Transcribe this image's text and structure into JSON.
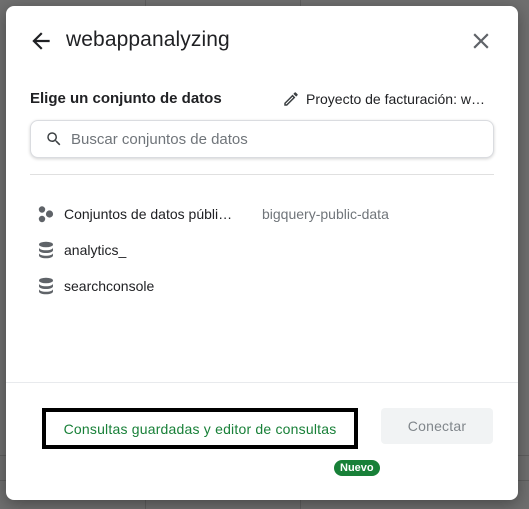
{
  "dialog": {
    "title": "webappanalyzing",
    "section_label": "Elige un conjunto de datos",
    "project_label": "Proyecto de facturación: w…",
    "search": {
      "placeholder": "Buscar conjuntos de datos",
      "value": ""
    },
    "datasets": [
      {
        "name": "Conjuntos de datos públi…",
        "subtitle": "bigquery-public-data",
        "icon": "public-datasets-icon"
      },
      {
        "name": "analytics_",
        "subtitle": "",
        "icon": "database-icon"
      },
      {
        "name": "searchconsole",
        "subtitle": "",
        "icon": "database-icon"
      }
    ],
    "saved_queries_label": "Consultas guardadas y editor de consultas",
    "new_badge": "Nuevo",
    "connect_label": "Conectar"
  },
  "colors": {
    "accent_green": "#188038",
    "text_primary": "#202124",
    "text_secondary": "#70757a",
    "disabled_button_bg": "#f1f3f4"
  }
}
